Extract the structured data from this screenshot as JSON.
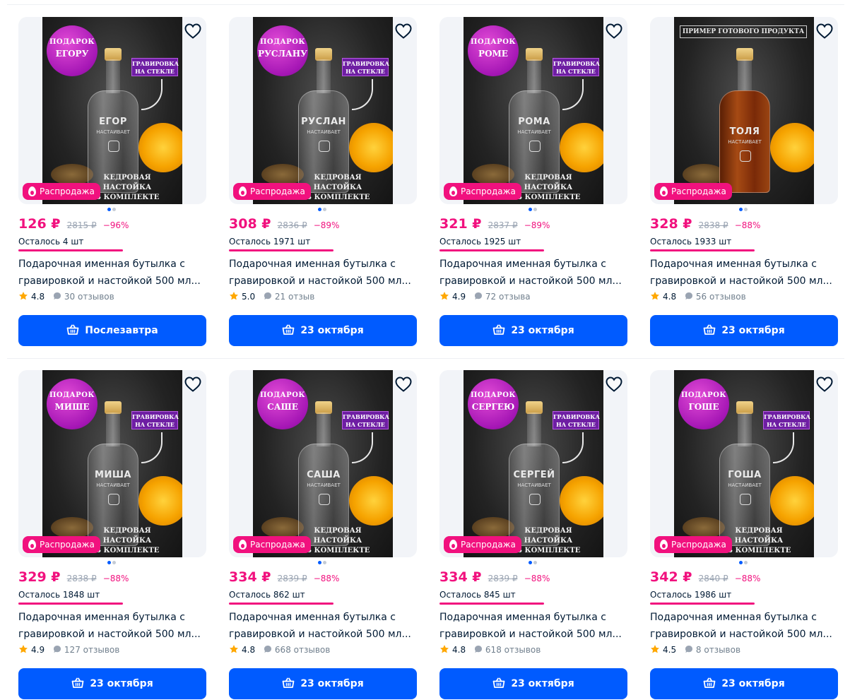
{
  "products": [
    {
      "badge_top": "ПОДАРОК",
      "badge_name": "ЕГОРУ",
      "engraved_name": "ЕГОР",
      "engraved_sub": "НАСТАИВАЕТ",
      "engrave_tag_1": "ГРАВИРОВКА",
      "engrave_tag_2": "НА СТЕКЛЕ",
      "caption_1": "КЕДРОВАЯ",
      "caption_2": "НАСТОЙКА",
      "caption_3": "В КОМПЛЕКТЕ",
      "sale": "Распродажа",
      "price": "126 ₽",
      "old_price": "2815 ₽",
      "discount": "−96%",
      "stock": "Осталось 4 шт",
      "title_1": "Подарочная именная бутылка с",
      "title_2": "гравировкой и настойкой 500 мл...",
      "rating": "4.8",
      "reviews": "30 отзывов",
      "delivery": "Послезавтра"
    },
    {
      "badge_top": "ПОДАРОК",
      "badge_name": "РУСЛАНУ",
      "engraved_name": "РУСЛАН",
      "engraved_sub": "НАСТАИВАЕТ",
      "engrave_tag_1": "ГРАВИРОВКА",
      "engrave_tag_2": "НА СТЕКЛЕ",
      "caption_1": "КЕДРОВАЯ",
      "caption_2": "НАСТОЙКА",
      "caption_3": "В КОМПЛЕКТЕ",
      "sale": "Распродажа",
      "price": "308 ₽",
      "old_price": "2836 ₽",
      "discount": "−89%",
      "stock": "Осталось 1971 шт",
      "title_1": "Подарочная именная бутылка с",
      "title_2": "гравировкой и настойкой 500 мл...",
      "rating": "5.0",
      "reviews": "21 отзыв",
      "delivery": "23 октября"
    },
    {
      "badge_top": "ПОДАРОК",
      "badge_name": "РОМЕ",
      "engraved_name": "РОМА",
      "engraved_sub": "НАСТАИВАЕТ",
      "engrave_tag_1": "ГРАВИРОВКА",
      "engrave_tag_2": "НА СТЕКЛЕ",
      "caption_1": "КЕДРОВАЯ",
      "caption_2": "НАСТОЙКА",
      "caption_3": "В КОМПЛЕКТЕ",
      "sale": "Распродажа",
      "price": "321 ₽",
      "old_price": "2837 ₽",
      "discount": "−89%",
      "stock": "Осталось 1925 шт",
      "title_1": "Подарочная именная бутылка с",
      "title_2": "гравировкой и настойкой 500 мл...",
      "rating": "4.9",
      "reviews": "72 отзыва",
      "delivery": "23 октября"
    },
    {
      "sample_tag": "ПРИМЕР ГОТОВОГО ПРОДУКТА",
      "engraved_name": "ТОЛЯ",
      "engraved_sub": "НАСТАИВАЕТ",
      "sale": "Распродажа",
      "price": "328 ₽",
      "old_price": "2838 ₽",
      "discount": "−88%",
      "stock": "Осталось 1933 шт",
      "title_1": "Подарочная именная бутылка с",
      "title_2": "гравировкой и настойкой 500 мл...",
      "rating": "4.8",
      "reviews": "56 отзывов",
      "delivery": "23 октября"
    },
    {
      "badge_top": "ПОДАРОК",
      "badge_name": "МИШЕ",
      "engraved_name": "МИША",
      "engraved_sub": "НАСТАИВАЕТ",
      "engrave_tag_1": "ГРАВИРОВКА",
      "engrave_tag_2": "НА СТЕКЛЕ",
      "caption_1": "КЕДРОВАЯ",
      "caption_2": "НАСТОЙКА",
      "caption_3": "В КОМПЛЕКТЕ",
      "sale": "Распродажа",
      "price": "329 ₽",
      "old_price": "2838 ₽",
      "discount": "−88%",
      "stock": "Осталось 1848 шт",
      "title_1": "Подарочная именная бутылка с",
      "title_2": "гравировкой и настойкой 500 мл...",
      "rating": "4.9",
      "reviews": "127 отзывов",
      "delivery": "23 октября"
    },
    {
      "badge_top": "ПОДАРОК",
      "badge_name": "САШЕ",
      "engraved_name": "САША",
      "engraved_sub": "НАСТАИВАЕТ",
      "engrave_tag_1": "ГРАВИРОВКА",
      "engrave_tag_2": "НА СТЕКЛЕ",
      "caption_1": "КЕДРОВАЯ",
      "caption_2": "НАСТОЙКА",
      "caption_3": "В КОМПЛЕКТЕ",
      "sale": "Распродажа",
      "price": "334 ₽",
      "old_price": "2839 ₽",
      "discount": "−88%",
      "stock": "Осталось 862 шт",
      "title_1": "Подарочная именная бутылка с",
      "title_2": "гравировкой и настойкой 500 мл...",
      "rating": "4.8",
      "reviews": "668 отзывов",
      "delivery": "23 октября"
    },
    {
      "badge_top": "ПОДАРОК",
      "badge_name": "СЕРГЕЮ",
      "engraved_name": "СЕРГЕЙ",
      "engraved_sub": "НАСТАИВАЕТ",
      "engrave_tag_1": "ГРАВИРОВКА",
      "engrave_tag_2": "НА СТЕКЛЕ",
      "caption_1": "КЕДРОВАЯ",
      "caption_2": "НАСТОЙКА",
      "caption_3": "В КОМПЛЕКТЕ",
      "sale": "Распродажа",
      "price": "334 ₽",
      "old_price": "2839 ₽",
      "discount": "−88%",
      "stock": "Осталось 845 шт",
      "title_1": "Подарочная именная бутылка с",
      "title_2": "гравировкой и настойкой 500 мл...",
      "rating": "4.8",
      "reviews": "618 отзывов",
      "delivery": "23 октября"
    },
    {
      "badge_top": "ПОДАРОК",
      "badge_name": "ГОШЕ",
      "engraved_name": "ГОША",
      "engraved_sub": "НАСТАИВАЕТ",
      "engrave_tag_1": "ГРАВИРОВКА",
      "engrave_tag_2": "НА СТЕКЛЕ",
      "caption_1": "КЕДРОВАЯ",
      "caption_2": "НАСТОЙКА",
      "caption_3": "В КОМПЛЕКТЕ",
      "sale": "Распродажа",
      "price": "342 ₽",
      "old_price": "2840 ₽",
      "discount": "−88%",
      "stock": "Осталось 1986 шт",
      "title_1": "Подарочная именная бутылка с",
      "title_2": "гравировкой и настойкой 500 мл...",
      "rating": "4.5",
      "reviews": "8 отзывов",
      "delivery": "23 октября"
    }
  ],
  "icons": {
    "heart": "heart-icon",
    "sale": "flame-icon",
    "rating": "star-icon",
    "reviews": "chat-bubble-icon",
    "delivery": "cart-icon"
  },
  "colors": {
    "accent_blue": "#005bff",
    "sale_pink": "#f1117e",
    "star_yellow": "#ffa800",
    "text_primary": "#001a34",
    "text_muted": "#707f8d"
  }
}
